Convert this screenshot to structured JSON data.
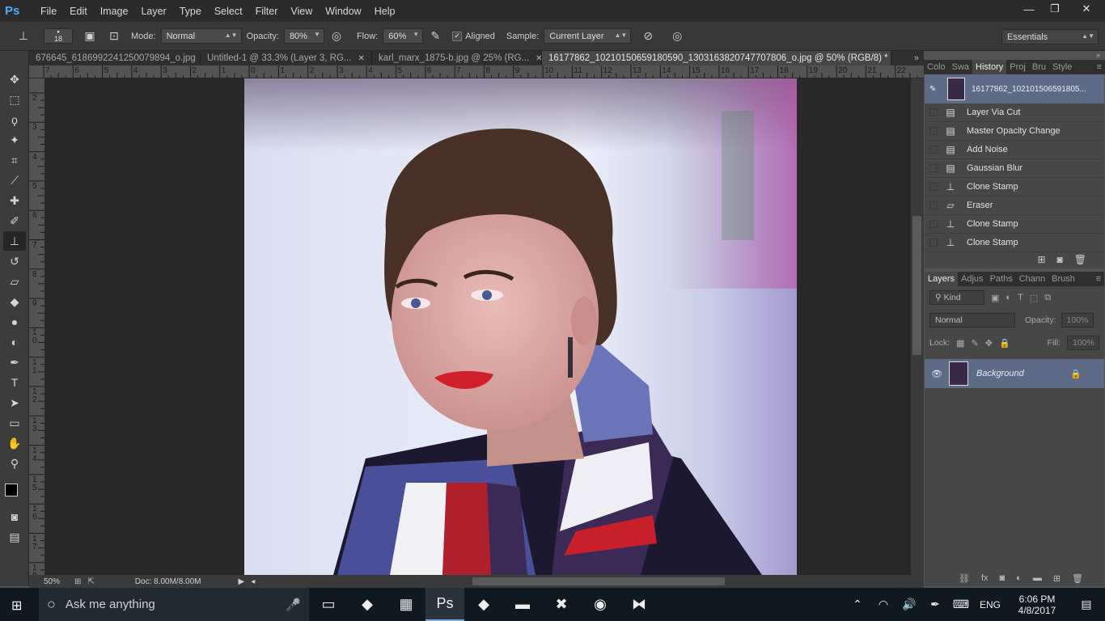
{
  "app": {
    "logo": "Ps"
  },
  "menu": [
    "File",
    "Edit",
    "Image",
    "Layer",
    "Type",
    "Select",
    "Filter",
    "View",
    "Window",
    "Help"
  ],
  "window_controls": {
    "minimize": "—",
    "restore": "❐",
    "close": "✕"
  },
  "options": {
    "brush_size": "18",
    "mode_label": "Mode:",
    "mode_value": "Normal",
    "opacity_label": "Opacity:",
    "opacity_value": "80%",
    "flow_label": "Flow:",
    "flow_value": "60%",
    "aligned_label": "Aligned",
    "sample_label": "Sample:",
    "sample_value": "Current Layer",
    "workspace": "Essentials"
  },
  "tabs": [
    {
      "label": "676645_6186992241250079894_o.jpg",
      "active": false
    },
    {
      "label": "Untitled-1 @ 33.3% (Layer 3, RG...",
      "active": false
    },
    {
      "label": "karl_marx_1875-b.jpg @ 25% (RG...",
      "active": false
    },
    {
      "label": "16177862_1021015065918059​0_1303163820747707806_o.jpg @ 50% (RGB/8) *",
      "active": true
    }
  ],
  "ruler_top": [
    "7",
    "6",
    "5",
    "4",
    "3",
    "2",
    "1",
    "0",
    "1",
    "2",
    "3",
    "4",
    "5",
    "6",
    "7",
    "8",
    "9",
    "10",
    "11",
    "12",
    "13",
    "14",
    "15",
    "16",
    "17",
    "18",
    "19",
    "20",
    "21",
    "22"
  ],
  "ruler_left": [
    "2",
    "3",
    "4",
    "5",
    "6",
    "7",
    "8",
    "9",
    "10",
    "11",
    "12",
    "13",
    "14",
    "15",
    "16",
    "17",
    "18"
  ],
  "status": {
    "zoom": "50%",
    "doc": "Doc: 8.00M/8.00M"
  },
  "panels": {
    "top_tabs": [
      "Colo",
      "Swa",
      "History",
      "Proj",
      "Bru",
      "Style"
    ],
    "history_snapshot": "16177862_102101506591805...",
    "history": [
      {
        "label": "Layer Via Cut",
        "icon": "doc-icon"
      },
      {
        "label": "Master Opacity Change",
        "icon": "doc-icon"
      },
      {
        "label": "Add Noise",
        "icon": "doc-icon"
      },
      {
        "label": "Gaussian Blur",
        "icon": "doc-icon"
      },
      {
        "label": "Clone Stamp",
        "icon": "stamp-icon"
      },
      {
        "label": "Eraser",
        "icon": "eraser-icon"
      },
      {
        "label": "Clone Stamp",
        "icon": "stamp-icon"
      },
      {
        "label": "Clone Stamp",
        "icon": "stamp-icon"
      }
    ],
    "layer_tabs": [
      "Layers",
      "Adjus",
      "Paths",
      "Chann",
      "Brush"
    ],
    "kind_label": "Kind",
    "blend_mode": "Normal",
    "opacity_label": "Opacity:",
    "opacity_value": "100%",
    "lock_label": "Lock:",
    "fill_label": "Fill:",
    "fill_value": "100%",
    "layer_name": "Background"
  },
  "taskbar": {
    "search_placeholder": "Ask me anything",
    "lang": "ENG",
    "time": "6:06 PM",
    "date": "4/8/2017"
  }
}
